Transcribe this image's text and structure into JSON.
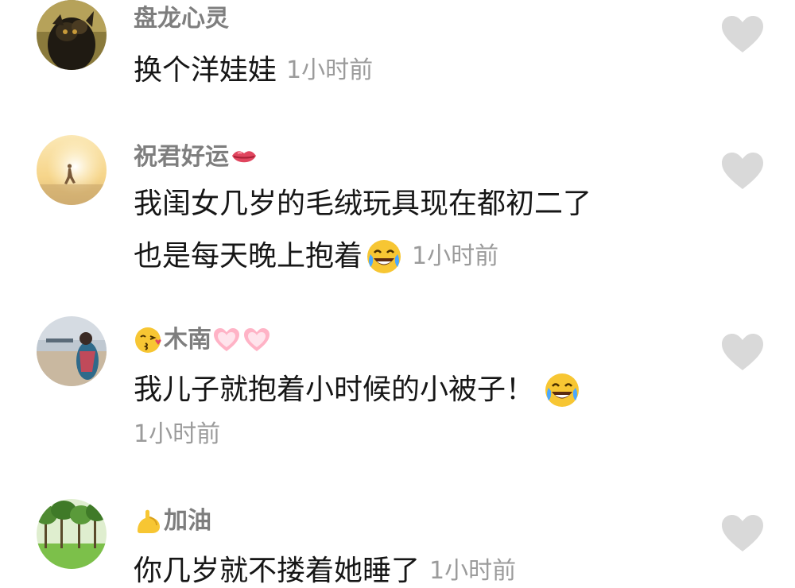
{
  "comments": [
    {
      "username": "盘龙心灵",
      "lines": [
        "换个洋娃娃"
      ],
      "time": "1小时前",
      "avatar_icon": "bronze-dragon-statue-avatar",
      "like_icon": "heart-icon"
    },
    {
      "username": "祝君好运",
      "username_emoji": "kiss-lips-icon",
      "lines": [
        "我闺女几岁的毛绒玩具现在都初二了",
        "也是每天晚上抱着"
      ],
      "line_emoji": "rolling-laughing-face-icon",
      "time": "1小时前",
      "avatar_icon": "sunset-runner-avatar",
      "like_icon": "heart-icon"
    },
    {
      "username": "木南",
      "username_emojis": [
        "kissing-face-icon",
        "pink-heart-icon",
        "pink-heart-icon"
      ],
      "lines": [
        "我儿子就抱着小时候的小被子！"
      ],
      "line_emoji": "rolling-laughing-face-icon",
      "time": "1小时前",
      "avatar_icon": "seaside-woman-avatar",
      "like_icon": "heart-icon"
    },
    {
      "username": "加油",
      "username_emoji": "flexed-biceps-icon",
      "lines": [
        "你几岁就不搂着她睡了"
      ],
      "time": "1小时前",
      "avatar_icon": "green-trees-avatar",
      "like_icon": "heart-icon"
    }
  ],
  "colors": {
    "username": "#7e7e7e",
    "text": "#161616",
    "time": "#9b9b9b",
    "like": "#d9d9d9"
  }
}
